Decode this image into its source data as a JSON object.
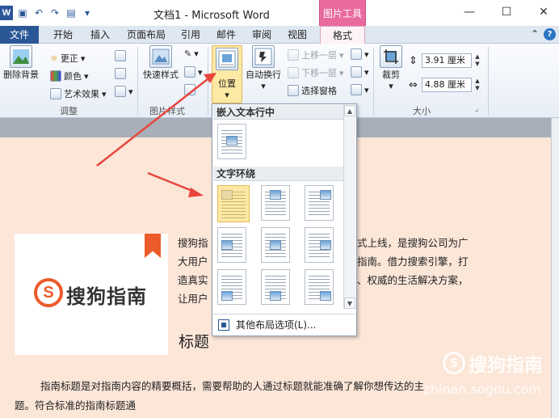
{
  "window": {
    "title": "文档1 - Microsoft Word",
    "context_tab": "图片工具",
    "minimize": "—",
    "maximize": "☐",
    "close": "✕"
  },
  "tabs": [
    "文件",
    "开始",
    "插入",
    "页面布局",
    "引用",
    "邮件",
    "审阅",
    "视图",
    "格式"
  ],
  "active_tab": "格式",
  "tab_right": {
    "collapse": "⌃",
    "help": "?"
  },
  "ribbon": {
    "remove_bg": "删除背景",
    "corrections": "更正",
    "color": "颜色",
    "artistic": "艺术效果",
    "adjust_label": "调整",
    "quick_styles": "快速样式",
    "picture_styles_label": "图片样式",
    "position": "位置",
    "wrap_text": "自动换行",
    "bring_forward": "上移一层",
    "send_backward": "下移一层",
    "selection_pane": "选择窗格",
    "crop": "裁剪",
    "height": "3.91 厘米",
    "width": "4.88 厘米",
    "size_label": "大小"
  },
  "dropdown": {
    "inline_section": "嵌入文本行中",
    "wrap_section": "文字环绕",
    "more_options": "其他布局选项(L)..."
  },
  "document": {
    "logo_text": "搜狗指南",
    "para1_line1_left": "搜狗指",
    "para1_line1_right": "式上线，是搜狗公司为广",
    "para1_line2_left": "大用户",
    "para1_line2_right": "指南。借力搜索引擎，打",
    "para1_line3_left": "造真实",
    "para1_line3_right": "、权威的生活解决方案，",
    "para1_line4_left": "让用户",
    "heading": "标题",
    "para2_line1": "指南标题是对指南内容的精要概括，需要帮助的人通过标题就能准确了解你想传达的主",
    "para2_line2": "题。符合标准的指南标题通"
  },
  "watermark": {
    "brand": "搜狗指南",
    "url": "zhinan.sogou.com"
  },
  "colors": {
    "accent": "#2b5797",
    "context": "#e96a9e",
    "arrow": "#e8453c",
    "logo": "#ec5b2a"
  }
}
